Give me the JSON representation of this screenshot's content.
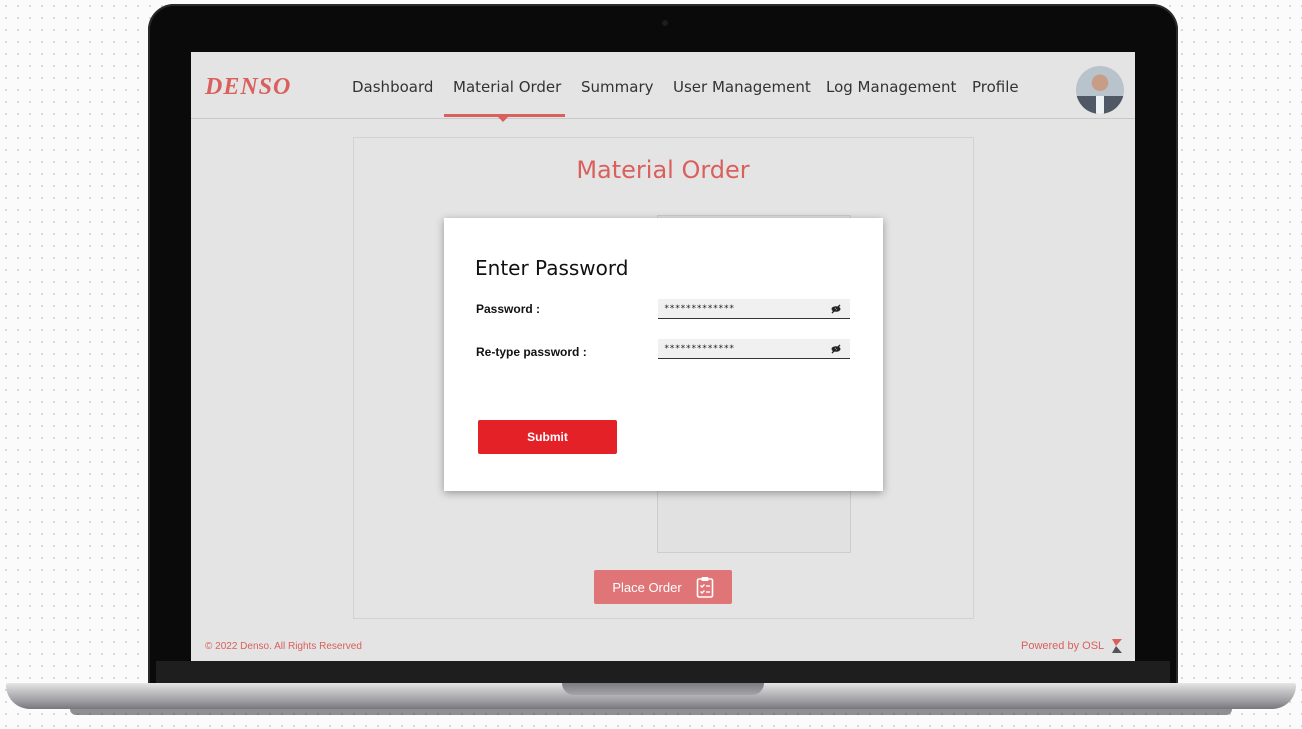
{
  "app": {
    "logo": "DENSO"
  },
  "nav": {
    "items": [
      {
        "label": "Dashboard"
      },
      {
        "label": "Material Order"
      },
      {
        "label": "Summary"
      },
      {
        "label": "User Management"
      },
      {
        "label": "Log Management"
      },
      {
        "label": "Profile"
      }
    ],
    "active": "Material Order"
  },
  "page": {
    "title": "Material Order",
    "place_order_label": "Place Order"
  },
  "modal": {
    "title": "Enter Password",
    "password_label": "Password :",
    "password_value": "*************",
    "retype_label": "Re-type password :",
    "retype_value": "*************",
    "submit_label": "Submit"
  },
  "footer": {
    "copyright": "© 2022 Denso. All Rights Reserved",
    "powered_by": "Powered by OSL"
  },
  "colors": {
    "brand": "#d9605d",
    "submit": "#e32127",
    "place_order": "#e07577"
  },
  "icons": {
    "password_toggle": "eye-slash-icon",
    "place_order": "clipboard-icon",
    "powered_by": "osl-logo-icon"
  }
}
